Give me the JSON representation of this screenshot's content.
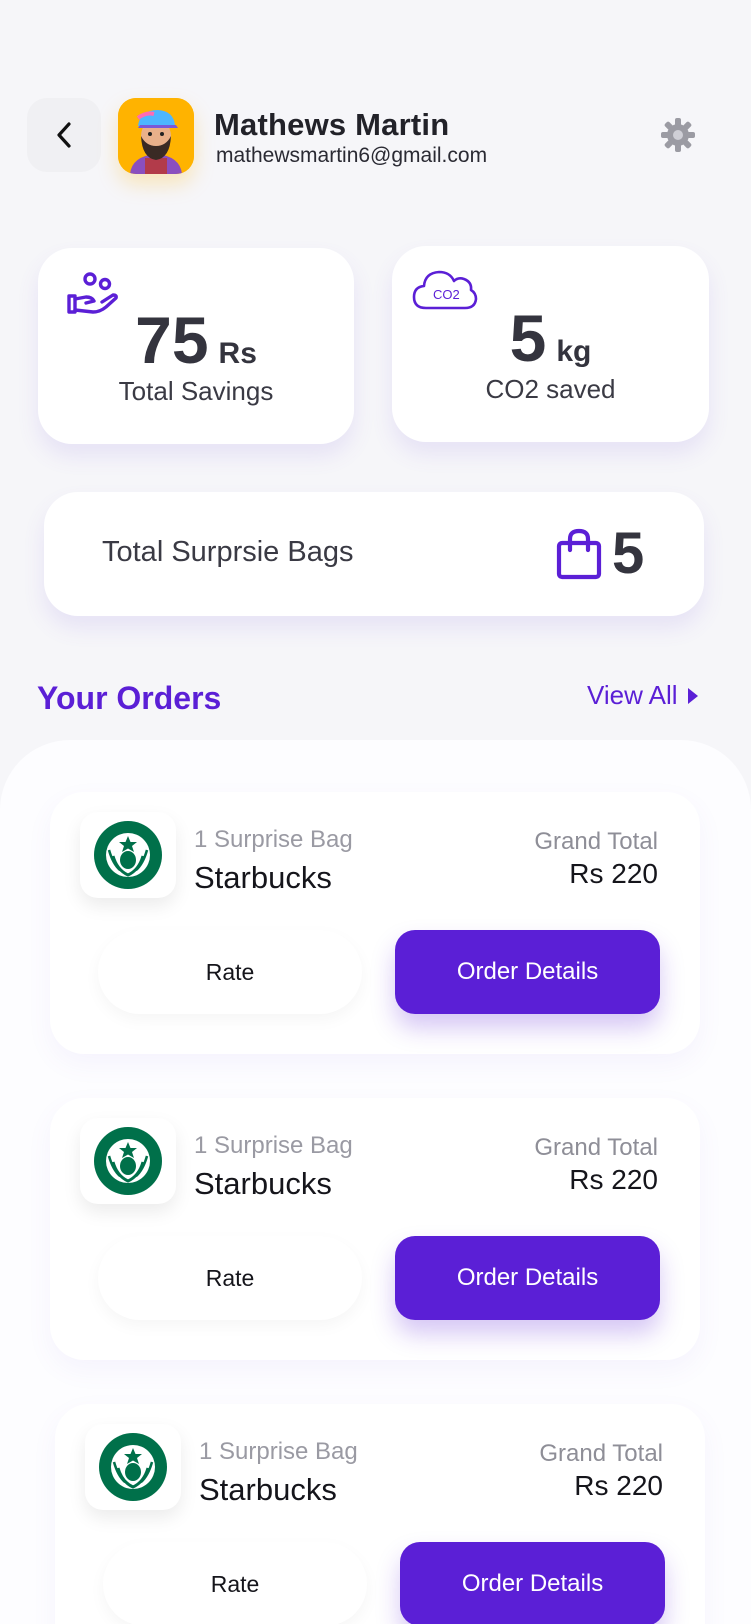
{
  "user": {
    "name": "Mathews Martin",
    "email": "mathewsmartin6@gmail.com"
  },
  "stats": {
    "savings": {
      "value": "75",
      "unit": "Rs",
      "label": "Total Savings"
    },
    "co2": {
      "value": "5",
      "unit": "kg",
      "label": "CO2 saved",
      "icon_text": "CO2"
    }
  },
  "bags": {
    "label": "Total Surprsie Bags",
    "count": "5"
  },
  "orders": {
    "title": "Your Orders",
    "view_all": "View All",
    "items": [
      {
        "bag_count": "1 Surprise Bag",
        "store": "Starbucks",
        "total_label": "Grand Total",
        "total": "Rs 220",
        "rate_label": "Rate",
        "details_label": "Order Details"
      },
      {
        "bag_count": "1 Surprise Bag",
        "store": "Starbucks",
        "total_label": "Grand Total",
        "total": "Rs 220",
        "rate_label": "Rate",
        "details_label": "Order Details"
      },
      {
        "bag_count": "1 Surprise Bag",
        "store": "Starbucks",
        "total_label": "Grand Total",
        "total": "Rs 220",
        "rate_label": "Rate",
        "details_label": "Order Details"
      }
    ]
  },
  "colors": {
    "accent": "#5b1fd6",
    "background": "#f6f6f9",
    "card": "#ffffff",
    "avatar_bg": "#ffb300",
    "starbucks_green": "#00704a"
  },
  "icons": {
    "back": "chevron-left-icon",
    "settings": "gear-icon",
    "savings": "hand-coins-icon",
    "co2": "cloud-co2-icon",
    "bags": "shopping-bag-icon",
    "view_all": "triangle-right-icon",
    "store_logo": "starbucks-logo"
  }
}
